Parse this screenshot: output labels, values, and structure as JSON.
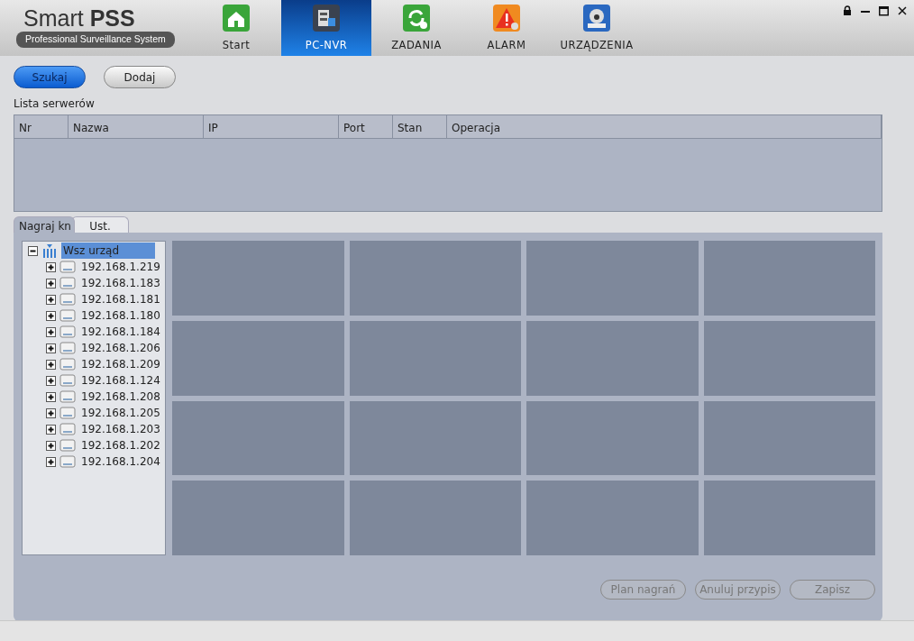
{
  "app": {
    "title": "Smart",
    "title_bold": "PSS",
    "subtitle": "Professional Surveillance System"
  },
  "nav": [
    {
      "label": "Start",
      "selected": false
    },
    {
      "label": "PC-NVR",
      "selected": true
    },
    {
      "label": "ZADANIA",
      "selected": false
    },
    {
      "label": "ALARM",
      "selected": false
    },
    {
      "label": "URZĄDZENIA",
      "selected": false
    }
  ],
  "toolbar": [
    {
      "label": "Szukaj",
      "selected": true
    },
    {
      "label": "Dodaj",
      "selected": false
    }
  ],
  "server_list": {
    "title": "Lista serwerów",
    "columns": [
      "Nr",
      "Nazwa",
      "IP",
      "Port",
      "Stan",
      "Operacja"
    ]
  },
  "tabs": [
    {
      "label": "Nagraj kn",
      "selected": true
    },
    {
      "label": "Ust.",
      "selected": false
    }
  ],
  "tree": {
    "label": "Wsz urząd",
    "expanded": true,
    "selected": true,
    "children": [
      {
        "label": "192.168.1.219",
        "expanded": false
      },
      {
        "label": "192.168.1.183",
        "expanded": false
      },
      {
        "label": "192.168.1.181",
        "expanded": false
      },
      {
        "label": "192.168.1.180",
        "expanded": false
      },
      {
        "label": "192.168.1.184",
        "expanded": false
      },
      {
        "label": "192.168.1.206",
        "expanded": false
      },
      {
        "label": "192.168.1.209",
        "expanded": false
      },
      {
        "label": "192.168.1.124",
        "expanded": false
      },
      {
        "label": "192.168.1.208",
        "expanded": false
      },
      {
        "label": "192.168.1.205",
        "expanded": false
      },
      {
        "label": "192.168.1.203",
        "expanded": false
      },
      {
        "label": "192.168.1.202",
        "expanded": false
      },
      {
        "label": "192.168.1.204",
        "expanded": false
      }
    ]
  },
  "actions": [
    {
      "label": "Plan nagrań",
      "disabled": true
    },
    {
      "label": "Anuluj przypis",
      "disabled": true
    },
    {
      "label": "Zapisz",
      "disabled": true
    }
  ]
}
